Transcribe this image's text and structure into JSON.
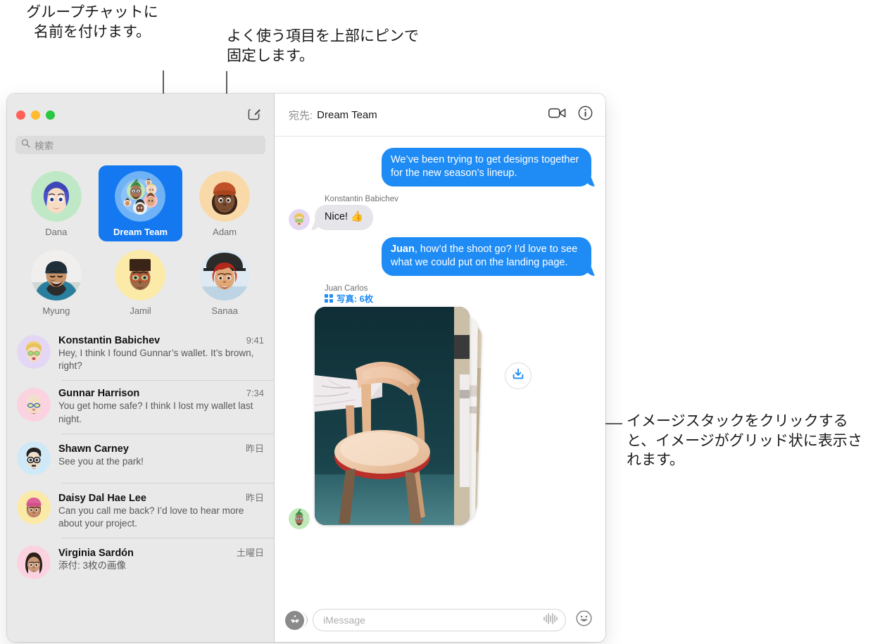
{
  "callouts": {
    "group_name": "グループチャットに名前を付けます。",
    "pin_top": "よく使う項目を上部にピンで固定します。",
    "image_stack": "イメージスタックをクリックすると、イメージがグリッド状に表示されます。"
  },
  "window": {
    "traffic_lights": {
      "close": "close-button",
      "minimize": "minimize-button",
      "zoom": "zoom-button"
    },
    "compose_icon": "compose-icon"
  },
  "sidebar": {
    "search": {
      "placeholder": "検索",
      "icon": "search-icon"
    },
    "pinned": [
      {
        "label": "Dana",
        "selected": false,
        "bg": "#bfe9c6"
      },
      {
        "label": "Dream Team",
        "selected": true,
        "bg": "#6fb2f5"
      },
      {
        "label": "Adam",
        "selected": false,
        "bg": "#f9d9a8"
      },
      {
        "label": "Myung",
        "selected": false,
        "bg": "#efefef"
      },
      {
        "label": "Jamil",
        "selected": false,
        "bg": "#fbeaa8"
      },
      {
        "label": "Sanaa",
        "selected": false,
        "bg": "#dfe9f2"
      }
    ],
    "conversations": [
      {
        "name": "Konstantin Babichev",
        "time": "9:41",
        "snippet": "Hey, I think I found Gunnar’s wallet. It’s brown, right?",
        "avatar_bg": "#e3d7f5"
      },
      {
        "name": "Gunnar Harrison",
        "time": "7:34",
        "snippet": "You get home safe? I think I lost my wallet last night.",
        "avatar_bg": "#fbd3e0"
      },
      {
        "name": "Shawn Carney",
        "time": "昨日",
        "snippet": "See you at the park!",
        "avatar_bg": "#cfe9f7"
      },
      {
        "name": "Daisy Dal Hae Lee",
        "time": "昨日",
        "snippet": "Can you call me back? I’d love to hear more about your project.",
        "avatar_bg": "#fbe9a8"
      },
      {
        "name": "Virginia Sardón",
        "time": "土曜日",
        "snippet": "添付: 3枚の画像",
        "avatar_bg": "#fbd3e0"
      }
    ]
  },
  "conversation": {
    "to_label": "宛先:",
    "to_name": "Dream Team",
    "facetime_icon": "video-camera-icon",
    "info_icon": "info-icon",
    "messages": [
      {
        "direction": "outgoing",
        "text": "We’ve been trying to get designs together for the new season’s lineup."
      },
      {
        "direction": "incoming",
        "sender": "Konstantin Babichev",
        "text": "Nice!  👍"
      },
      {
        "direction": "outgoing",
        "bold_prefix": "Juan",
        "text": ", how’d the shoot go? I’d love to see what we could put on the landing page."
      }
    ],
    "attachment": {
      "sender": "Juan Carlos",
      "kind_label": "写真: 6枚",
      "grid_icon": "photo-grid-icon",
      "download_icon": "download-icon",
      "photo_alt": "chair-and-marble-table-photo"
    },
    "composer": {
      "appstore_icon": "app-store-icon",
      "placeholder": "iMessage",
      "audio_icon": "audio-waveform-icon",
      "emoji_icon": "emoji-smiley-icon"
    }
  },
  "colors": {
    "accent_blue": "#1f8cf5",
    "selected_pin": "#1478f0",
    "sidebar_bg": "#e9e9e9",
    "incoming_bubble": "#e6e5e9"
  }
}
